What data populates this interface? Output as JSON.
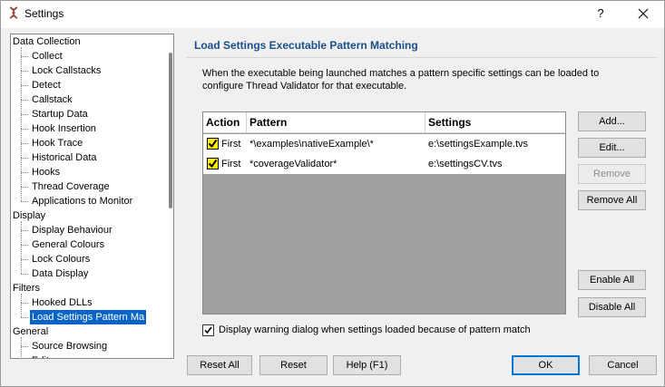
{
  "window": {
    "title": "Settings",
    "help_glyph": "?",
    "close_glyph": "✕"
  },
  "tree": {
    "items": [
      {
        "label": "Data Collection",
        "level": 0
      },
      {
        "label": "Collect",
        "level": 1
      },
      {
        "label": "Lock Callstacks",
        "level": 1
      },
      {
        "label": "Detect",
        "level": 1
      },
      {
        "label": "Callstack",
        "level": 1
      },
      {
        "label": "Startup Data",
        "level": 1
      },
      {
        "label": "Hook Insertion",
        "level": 1
      },
      {
        "label": "Hook Trace",
        "level": 1
      },
      {
        "label": "Historical Data",
        "level": 1
      },
      {
        "label": "Hooks",
        "level": 1
      },
      {
        "label": "Thread Coverage",
        "level": 1
      },
      {
        "label": "Applications to Monitor",
        "level": 1
      },
      {
        "label": "Display",
        "level": 0
      },
      {
        "label": "Display Behaviour",
        "level": 1
      },
      {
        "label": "General Colours",
        "level": 1
      },
      {
        "label": "Lock Colours",
        "level": 1
      },
      {
        "label": "Data Display",
        "level": 1
      },
      {
        "label": "Filters",
        "level": 0
      },
      {
        "label": "Hooked DLLs",
        "level": 1
      },
      {
        "label": "Load Settings Pattern Ma",
        "level": 1,
        "selected": true
      },
      {
        "label": "General",
        "level": 0
      },
      {
        "label": "Source Browsing",
        "level": 1
      },
      {
        "label": "Edit",
        "level": 1
      }
    ]
  },
  "page": {
    "title": "Load Settings Executable Pattern Matching",
    "description": "When the executable being launched matches a pattern specific settings can be loaded to configure Thread Validator for that executable."
  },
  "table": {
    "columns": [
      "Action",
      "Pattern",
      "Settings"
    ],
    "rows": [
      {
        "checked": true,
        "action": "First",
        "pattern": "*\\examples\\nativeExample\\*",
        "settings": "e:\\settingsExample.tvs"
      },
      {
        "checked": true,
        "action": "First",
        "pattern": "*coverageValidator*",
        "settings": "e:\\settingsCV.tvs"
      }
    ]
  },
  "side_buttons": {
    "add": "Add...",
    "edit": "Edit...",
    "remove": "Remove",
    "remove_all": "Remove All",
    "enable_all": "Enable All",
    "disable_all": "Disable All"
  },
  "warning_option": {
    "checked": true,
    "label": "Display warning dialog when settings loaded because of pattern match"
  },
  "footer": {
    "reset_all": "Reset All",
    "reset": "Reset",
    "help": "Help (F1)",
    "ok": "OK",
    "cancel": "Cancel"
  },
  "colors": {
    "title_blue": "#1a4f8a",
    "selection": "#0a64c8",
    "checkbox_fill": "#ffee00",
    "table_bg": "#a0a0a0"
  }
}
